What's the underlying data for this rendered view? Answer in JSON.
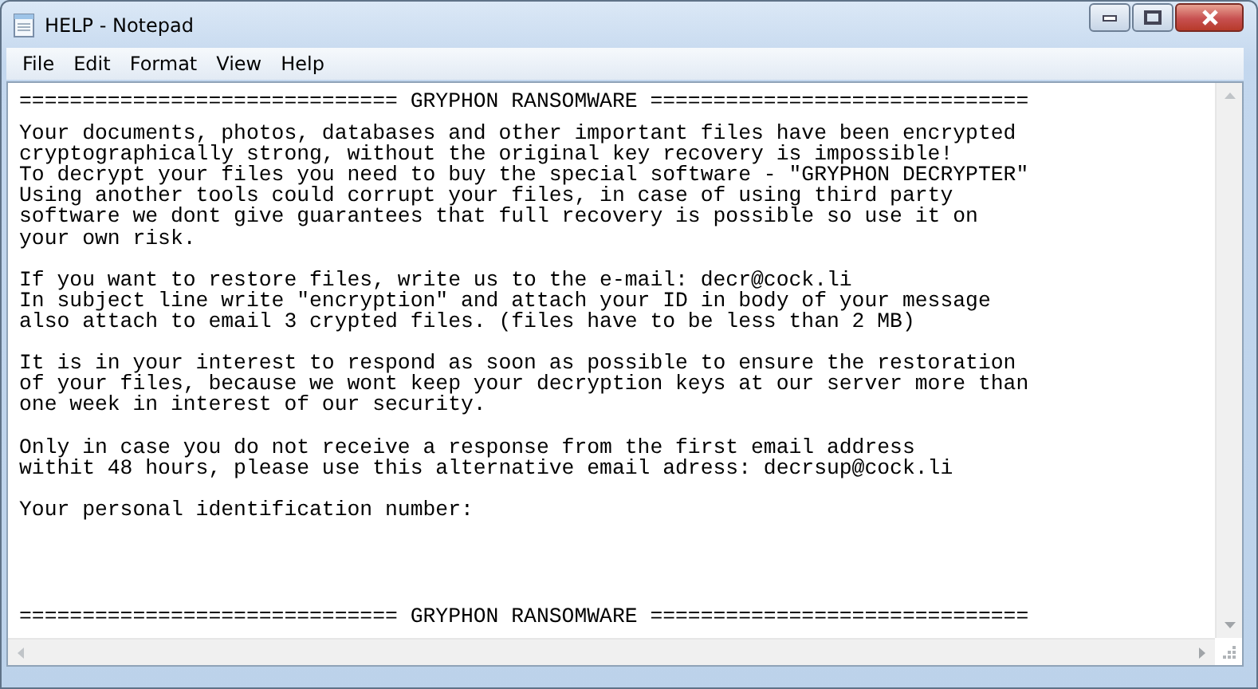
{
  "window": {
    "title": "HELP - Notepad"
  },
  "menu": [
    "File",
    "Edit",
    "Format",
    "View",
    "Help"
  ],
  "document": [
    {
      "kind": "separator",
      "text": "============================== GRYPHON RANSOMWARE =============================="
    },
    {
      "kind": "paragraph",
      "lines": [
        "Your documents, photos, databases and other important files have been encrypted",
        "cryptographically strong, without the original key recovery is impossible!",
        "To decrypt your files you need to buy the special software - \"GRYPHON DECRYPTER\"",
        "Using another tools could corrupt your files, in case of using third party",
        "software we dont give guarantees that full recovery is possible so use it on",
        "your own risk."
      ]
    },
    {
      "kind": "paragraph",
      "lines": [
        "If you want to restore files, write us to the e-mail: decr@cock.li",
        "In subject line write \"encryption\" and attach your ID in body of your message",
        "also attach to email 3 crypted files. (files have to be less than 2 MB)"
      ]
    },
    {
      "kind": "paragraph",
      "lines": [
        "It is in your interest to respond as soon as possible to ensure the restoration",
        "of your files, because we wont keep your decryption keys at our server more than",
        "one week in interest of our security."
      ]
    },
    {
      "kind": "paragraph",
      "lines": [
        "Only in case you do not receive a response from the first email address",
        "withit 48 hours, please use this alternative email adress: decrsup@cock.li"
      ]
    },
    {
      "kind": "paragraph",
      "lines": [
        "Your personal identification number:"
      ]
    },
    {
      "kind": "separator",
      "text": "============================== GRYPHON RANSOMWARE =============================="
    }
  ]
}
